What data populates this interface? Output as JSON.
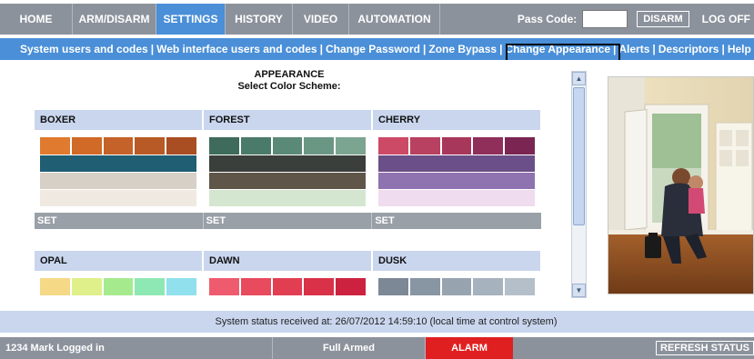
{
  "nav": {
    "home": "HOME",
    "arm_disarm": "ARM/DISARM",
    "settings": "SETTINGS",
    "history": "HISTORY",
    "video": "VIDEO",
    "automation": "AUTOMATION",
    "pass_code_label": "Pass Code:",
    "pass_code_value": "",
    "disarm": "DISARM",
    "log_off": "LOG OFF"
  },
  "subnav": {
    "items": [
      "System users and codes",
      "Web interface users and codes",
      "Change Password",
      "Zone Bypass",
      "Change Appearance",
      "Alerts",
      "Descriptors",
      "Help"
    ],
    "separator": "|",
    "active": "Change Appearance"
  },
  "appearance": {
    "title": "APPEARANCE",
    "subtitle": "Select Color Scheme:",
    "set_label": "SET",
    "schemes": [
      {
        "name": "BOXER",
        "swatches": [
          "#e07a2e",
          "#d06a26",
          "#c4622a",
          "#b85a25",
          "#a84e22"
        ],
        "bands": [
          "#1f5e73",
          "#d6d0c6",
          "#efe9e1"
        ]
      },
      {
        "name": "FOREST",
        "swatches": [
          "#3e6b5c",
          "#4a7a69",
          "#5a8a77",
          "#6a9784",
          "#7ba491"
        ],
        "bands": [
          "#3b3f3c",
          "#5f5548",
          "#d4e6cf"
        ]
      },
      {
        "name": "CHERRY",
        "swatches": [
          "#cc4a66",
          "#b84060",
          "#a8375c",
          "#8f2f5a",
          "#7a2552"
        ],
        "bands": [
          "#6a4f88",
          "#8f72b0",
          "#efdcee"
        ]
      },
      {
        "name": "OPAL",
        "swatches": [
          "#f5d987",
          "#dff08a",
          "#a6ea8e",
          "#8ee8b4",
          "#90e0ee"
        ],
        "bands": []
      },
      {
        "name": "DAWN",
        "swatches": [
          "#ef5b6e",
          "#e84a5e",
          "#e23e52",
          "#d83148",
          "#cc2240"
        ],
        "bands": []
      },
      {
        "name": "DUSK",
        "swatches": [
          "#7c8895",
          "#8895a2",
          "#97a4b0",
          "#a6b2bd",
          "#b4bfc9"
        ],
        "bands": []
      }
    ]
  },
  "status": {
    "message": "System status received at: 26/07/2012 14:59:10 (local time at control system)"
  },
  "footer": {
    "user": "1234 Mark Logged in",
    "armed": "Full Armed",
    "alarm": "ALARM",
    "refresh": "REFRESH STATUS"
  },
  "colors": {
    "nav_bg": "#8c929c",
    "accent_blue": "#4a8fd8",
    "header_light": "#c9d6ee",
    "alarm_red": "#e02020"
  },
  "icons": {
    "scroll_up": "scroll-up-arrow-icon",
    "scroll_down": "scroll-down-arrow-icon"
  }
}
